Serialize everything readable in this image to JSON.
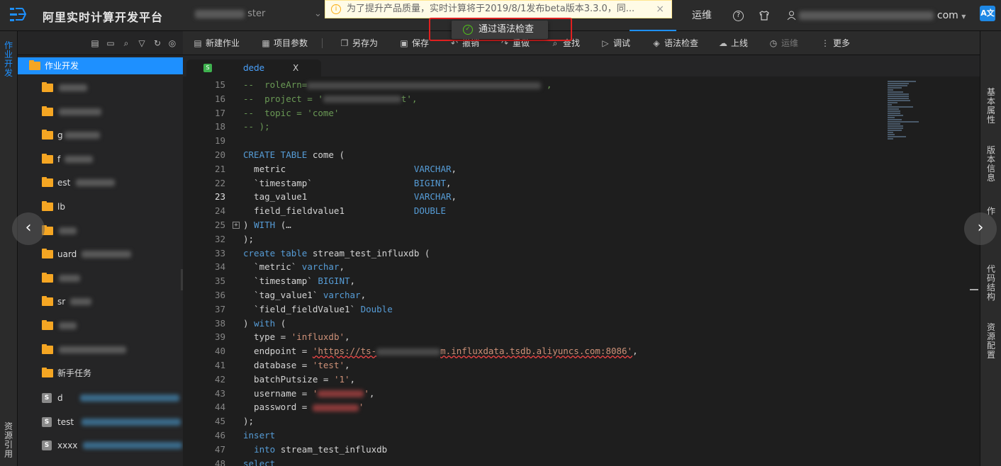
{
  "app": {
    "title": "阿里实时计算开发平台",
    "project_suffix": "ster"
  },
  "notice": {
    "text": "为了提升产品质量，实时计算将于2019/8/1发布beta版本3.3.0，同...",
    "close": "×"
  },
  "toast": {
    "text": "通过语法检查"
  },
  "topnav": {
    "ops": "运维",
    "user_suffix": "com"
  },
  "left_rail": {
    "top_tab": "作业开发",
    "bottom_tab": "资源引用"
  },
  "sidebar": {
    "root": "作业开发",
    "folders": [
      {
        "label": ""
      },
      {
        "label": ""
      },
      {
        "label": "g"
      },
      {
        "label": "f"
      },
      {
        "label": "est"
      },
      {
        "label": "lb"
      },
      {
        "label": ""
      },
      {
        "label": "uard"
      },
      {
        "label": ""
      },
      {
        "label": "sr"
      },
      {
        "label": ""
      },
      {
        "label": ""
      },
      {
        "label": "新手任务"
      }
    ],
    "files": [
      {
        "badge": "S",
        "label": "d"
      },
      {
        "badge": "S",
        "label": "test"
      },
      {
        "badge": "S",
        "label": "xxxx"
      }
    ]
  },
  "toolbar": {
    "new_job": "新建作业",
    "project_params": "项目参数",
    "save_as": "另存为",
    "save": "保存",
    "undo": "撤销",
    "redo": "重做",
    "find": "查找",
    "debug": "调试",
    "syntax_check": "语法检查",
    "go_online": "上线",
    "ops": "运维",
    "more": "更多"
  },
  "tab": {
    "badge": "S",
    "name": "dede",
    "close": "X"
  },
  "right_rail": [
    "基本属性",
    "版本信息",
    "作",
    "代码结构",
    "资源配置"
  ],
  "editor": {
    "lines": [
      {
        "n": "15",
        "segs": [
          {
            "t": "--  roleArn=",
            "c": "cm"
          },
          {
            "t": "",
            "c": "blur"
          },
          {
            "t": " ,",
            "c": "cm"
          }
        ]
      },
      {
        "n": "16",
        "segs": [
          {
            "t": "--  project = '",
            "c": "cm"
          },
          {
            "t": "",
            "c": "blur"
          },
          {
            "t": "t',",
            "c": "cm"
          }
        ]
      },
      {
        "n": "17",
        "segs": [
          {
            "t": "--  topic = 'come'",
            "c": "cm"
          }
        ]
      },
      {
        "n": "18",
        "segs": [
          {
            "t": "-- );",
            "c": "cm"
          }
        ]
      },
      {
        "n": "19",
        "segs": []
      },
      {
        "n": "20",
        "segs": [
          {
            "t": "CREATE TABLE",
            "c": "kw"
          },
          {
            "t": " come (",
            "c": ""
          }
        ]
      },
      {
        "n": "21",
        "segs": [
          {
            "t": "  metric                        ",
            "c": ""
          },
          {
            "t": "VARCHAR",
            "c": "kw"
          },
          {
            "t": ",",
            "c": ""
          }
        ]
      },
      {
        "n": "22",
        "segs": [
          {
            "t": "  `timestamp`                   ",
            "c": ""
          },
          {
            "t": "BIGINT",
            "c": "kw"
          },
          {
            "t": ",",
            "c": ""
          }
        ]
      },
      {
        "n": "23",
        "segs": [
          {
            "t": "  tag_value1                    ",
            "c": ""
          },
          {
            "t": "VARCHAR",
            "c": "kw"
          },
          {
            "t": ",",
            "c": ""
          }
        ]
      },
      {
        "n": "24",
        "segs": [
          {
            "t": "  field_fieldvalue1             ",
            "c": ""
          },
          {
            "t": "DOUBLE",
            "c": "kw"
          }
        ]
      },
      {
        "n": "25",
        "segs": [
          {
            "t": ") ",
            "c": ""
          },
          {
            "t": "WITH",
            "c": "kw"
          },
          {
            "t": " (…",
            "c": ""
          }
        ]
      },
      {
        "n": "32",
        "segs": [
          {
            "t": ");",
            "c": ""
          }
        ]
      },
      {
        "n": "33",
        "segs": [
          {
            "t": "create table",
            "c": "kw"
          },
          {
            "t": " stream_test_influxdb (",
            "c": ""
          }
        ]
      },
      {
        "n": "34",
        "segs": [
          {
            "t": "  `metric` ",
            "c": ""
          },
          {
            "t": "varchar",
            "c": "kw"
          },
          {
            "t": ",",
            "c": ""
          }
        ]
      },
      {
        "n": "35",
        "segs": [
          {
            "t": "  `timestamp` ",
            "c": ""
          },
          {
            "t": "BIGINT",
            "c": "kw"
          },
          {
            "t": ",",
            "c": ""
          }
        ]
      },
      {
        "n": "36",
        "segs": [
          {
            "t": "  `tag_value1` ",
            "c": ""
          },
          {
            "t": "varchar",
            "c": "kw"
          },
          {
            "t": ",",
            "c": ""
          }
        ]
      },
      {
        "n": "37",
        "segs": [
          {
            "t": "  `field_fieldValue1` ",
            "c": ""
          },
          {
            "t": "Double",
            "c": "kw"
          }
        ]
      },
      {
        "n": "38",
        "segs": [
          {
            "t": ") ",
            "c": ""
          },
          {
            "t": "with",
            "c": "kw"
          },
          {
            "t": " (",
            "c": ""
          }
        ]
      },
      {
        "n": "39",
        "segs": [
          {
            "t": "  type = ",
            "c": ""
          },
          {
            "t": "'influxdb'",
            "c": "str"
          },
          {
            "t": ",",
            "c": ""
          }
        ]
      },
      {
        "n": "40",
        "segs": [
          {
            "t": "  endpoint = ",
            "c": ""
          },
          {
            "t": "'https://ts-",
            "c": "str err"
          },
          {
            "t": "",
            "c": "blur"
          },
          {
            "t": "m.influxdata.tsdb.aliyuncs.com:8086'",
            "c": "str err"
          },
          {
            "t": ",",
            "c": ""
          }
        ]
      },
      {
        "n": "41",
        "segs": [
          {
            "t": "  database = ",
            "c": ""
          },
          {
            "t": "'test'",
            "c": "str"
          },
          {
            "t": ",",
            "c": ""
          }
        ]
      },
      {
        "n": "42",
        "segs": [
          {
            "t": "  batchPutsize = ",
            "c": ""
          },
          {
            "t": "'1'",
            "c": "str"
          },
          {
            "t": ",",
            "c": ""
          }
        ]
      },
      {
        "n": "43",
        "segs": [
          {
            "t": "  username = ",
            "c": ""
          },
          {
            "t": "'",
            "c": "str"
          },
          {
            "t": "",
            "c": "blur"
          },
          {
            "t": "'",
            "c": "str"
          },
          {
            "t": ",",
            "c": ""
          }
        ]
      },
      {
        "n": "44",
        "segs": [
          {
            "t": "  password = ",
            "c": ""
          },
          {
            "t": "",
            "c": "blur"
          },
          {
            "t": "'",
            "c": "str"
          }
        ]
      },
      {
        "n": "45",
        "segs": [
          {
            "t": ");",
            "c": ""
          }
        ]
      },
      {
        "n": "46",
        "segs": [
          {
            "t": "insert",
            "c": "kw"
          }
        ]
      },
      {
        "n": "47",
        "segs": [
          {
            "t": "  ",
            "c": ""
          },
          {
            "t": "into",
            "c": "kw"
          },
          {
            "t": " stream_test_influxdb",
            "c": ""
          }
        ]
      },
      {
        "n": "48",
        "segs": [
          {
            "t": "select",
            "c": "kw"
          }
        ]
      }
    ],
    "current_line": "23"
  },
  "colors": {
    "accent": "#1e90ff",
    "keyword": "#569cd6",
    "string": "#ce9178",
    "comment": "#6a9955",
    "folder": "#f5a623",
    "highlight_border": "#e02020"
  }
}
